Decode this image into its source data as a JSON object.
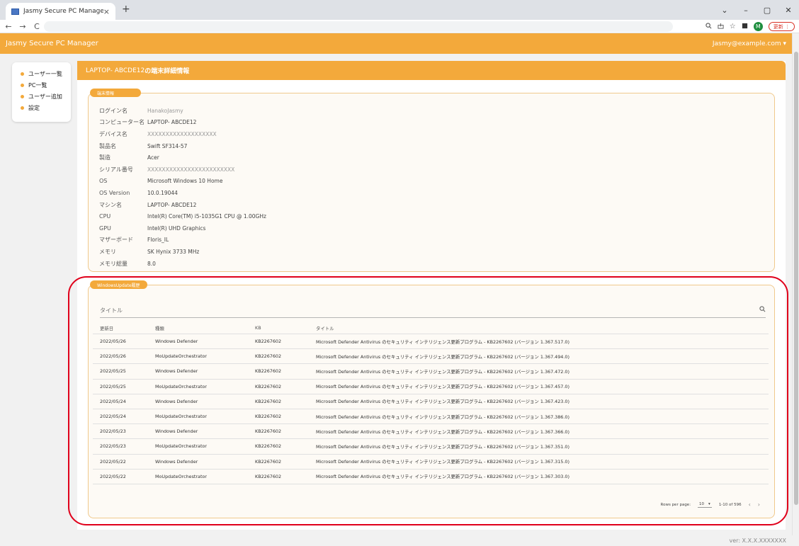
{
  "browser": {
    "tab_title": "Jasmy Secure PC Manager",
    "tab_close": "×",
    "new_tab": "+",
    "update_label": "更新",
    "avatar_letter": "M",
    "win_dropdown": "⌄",
    "win_minimize": "–",
    "win_maximize": "▢",
    "win_close": "✕",
    "back": "←",
    "forward": "→",
    "reload": "C"
  },
  "header": {
    "title": "Jasmy Secure PC Manager",
    "user": "Jasmy@example.com ▾"
  },
  "sidebar": {
    "items": [
      {
        "label": "ユーザー一覧"
      },
      {
        "label": "PC一覧"
      },
      {
        "label": "ユーザー追加"
      },
      {
        "label": "設定"
      }
    ]
  },
  "main": {
    "title_device": "LAPTOP- ABCDE12",
    "title_suffix": " の端末詳細情報"
  },
  "info": {
    "label": "端末情報",
    "rows": [
      {
        "key": "ログイン名",
        "value": "HanakoJasmy"
      },
      {
        "key": "コンピューター名",
        "value": "LAPTOP- ABCDE12"
      },
      {
        "key": "デバイス名",
        "value": "XXXXXXXXXXXXXXXXXXX"
      },
      {
        "key": "製品名",
        "value": "Swift SF314-57"
      },
      {
        "key": "製造",
        "value": "Acer"
      },
      {
        "key": "シリアル番号",
        "value": "XXXXXXXXXXXXXXXXXXXXXXXX"
      },
      {
        "key": "OS",
        "value": "Microsoft Windows 10 Home"
      },
      {
        "key": "OS Version",
        "value": "10.0.19044"
      },
      {
        "key": "マシン名",
        "value": "LAPTOP- ABCDE12"
      },
      {
        "key": "CPU",
        "value": "Intel(R) Core(TM) i5-1035G1 CPU @ 1.00GHz"
      },
      {
        "key": "GPU",
        "value": "Intel(R) UHD Graphics"
      },
      {
        "key": "マザーボード",
        "value": "Floris_IL"
      },
      {
        "key": "メモリ",
        "value": "SK Hynix 3733 MHz"
      },
      {
        "key": "メモリ総量",
        "value": "8.0"
      }
    ]
  },
  "windows_update": {
    "label": "WindowsUpdate履歴",
    "search_placeholder": "タイトル",
    "columns": [
      "更新日",
      "種類",
      "KB",
      "タイトル"
    ],
    "rows": [
      {
        "date": "2022/05/26",
        "type": "Windows Defender",
        "kb": "KB2267602",
        "title": "Microsoft Defender Antivirus のセキュリティ インテリジェンス更新プログラム - KB2267602 (バージョン 1.367.517.0)"
      },
      {
        "date": "2022/05/26",
        "type": "MoUpdateOrchestrator",
        "kb": "KB2267602",
        "title": "Microsoft Defender Antivirus のセキュリティ インテリジェンス更新プログラム - KB2267602 (バージョン 1.367.494.0)"
      },
      {
        "date": "2022/05/25",
        "type": "Windows Defender",
        "kb": "KB2267602",
        "title": "Microsoft Defender Antivirus のセキュリティ インテリジェンス更新プログラム - KB2267602 (バージョン 1.367.472.0)"
      },
      {
        "date": "2022/05/25",
        "type": "MoUpdateOrchestrator",
        "kb": "KB2267602",
        "title": "Microsoft Defender Antivirus のセキュリティ インテリジェンス更新プログラム - KB2267602 (バージョン 1.367.457.0)"
      },
      {
        "date": "2022/05/24",
        "type": "Windows Defender",
        "kb": "KB2267602",
        "title": "Microsoft Defender Antivirus のセキュリティ インテリジェンス更新プログラム - KB2267602 (バージョン 1.367.423.0)"
      },
      {
        "date": "2022/05/24",
        "type": "MoUpdateOrchestrator",
        "kb": "KB2267602",
        "title": "Microsoft Defender Antivirus のセキュリティ インテリジェンス更新プログラム - KB2267602 (バージョン 1.367.386.0)"
      },
      {
        "date": "2022/05/23",
        "type": "Windows Defender",
        "kb": "KB2267602",
        "title": "Microsoft Defender Antivirus のセキュリティ インテリジェンス更新プログラム - KB2267602 (バージョン 1.367.366.0)"
      },
      {
        "date": "2022/05/23",
        "type": "MoUpdateOrchestrator",
        "kb": "KB2267602",
        "title": "Microsoft Defender Antivirus のセキュリティ インテリジェンス更新プログラム - KB2267602 (バージョン 1.367.351.0)"
      },
      {
        "date": "2022/05/22",
        "type": "Windows Defender",
        "kb": "KB2267602",
        "title": "Microsoft Defender Antivirus のセキュリティ インテリジェンス更新プログラム - KB2267602 (バージョン 1.367.315.0)"
      },
      {
        "date": "2022/05/22",
        "type": "MoUpdateOrchestrator",
        "kb": "KB2267602",
        "title": "Microsoft Defender Antivirus のセキュリティ インテリジェンス更新プログラム - KB2267602 (バージョン 1.367.303.0)"
      }
    ],
    "pagination": {
      "rows_per_page_label": "Rows per page:",
      "rows_per_page": "10",
      "range": "1-10 of 596"
    }
  },
  "footer": {
    "version": "ver: X.X.X.XXXXXXX"
  },
  "colors": {
    "accent": "#f3a93b",
    "annotation": "#e0001b"
  },
  "icons": {
    "search": "search-icon",
    "prev": "chevron-left-icon",
    "next": "chevron-right-icon"
  }
}
